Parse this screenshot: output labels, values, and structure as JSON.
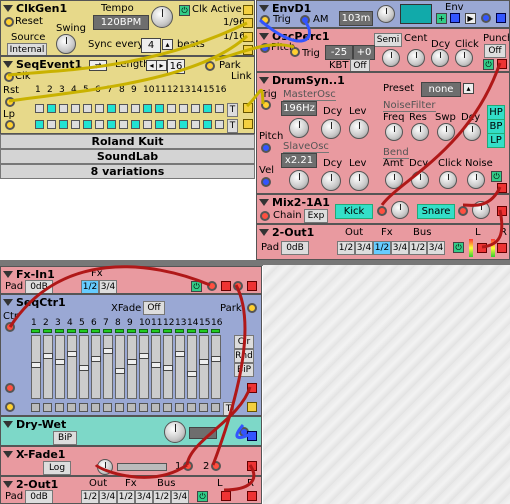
{
  "clkgen": {
    "title": "ClkGen1",
    "reset": "Reset",
    "tempo_label": "Tempo",
    "tempo": "120BPM",
    "swing": "Swing",
    "clk_active": "Clk Active",
    "source": "Source",
    "source_value": "Internal",
    "sync_every": "Sync every",
    "sync_value": "4",
    "beats": "beats",
    "div1": "1/96",
    "div2": "1/16"
  },
  "seqevent": {
    "title": "SeqEvent1",
    "length_label": "Length",
    "length": "16",
    "park": "Park",
    "clk": "Clk",
    "link": "Link",
    "rst": "Rst",
    "lp": "Lp",
    "steps": [
      "1",
      "2",
      "3",
      "4",
      "5",
      "6",
      "7",
      "8",
      "9",
      "10",
      "11",
      "12",
      "13",
      "14",
      "15",
      "16"
    ],
    "row1": [
      0,
      1,
      0,
      0,
      0,
      0,
      1,
      0,
      0,
      1,
      1,
      0,
      0,
      0,
      1,
      0
    ],
    "row2": [
      1,
      0,
      1,
      0,
      1,
      0,
      1,
      0,
      1,
      0,
      1,
      0,
      1,
      0,
      1,
      0
    ],
    "t": "T"
  },
  "info": {
    "line1": "Roland Kuit",
    "line2": "SoundLab",
    "line3": "8 variations"
  },
  "envd": {
    "title": "EnvD1",
    "trig": "Trig",
    "am": "AM",
    "decay": "103m",
    "env": "Env"
  },
  "oscperc": {
    "title": "OscPerc1",
    "pitch": "Pitch",
    "semi": "Semi",
    "cent": "Cent",
    "dcy": "Dcy",
    "click": "Click",
    "punch": "Punch",
    "punch_value": "Off",
    "trig": "Trig",
    "semi_value": "-25",
    "cent_value": "+0",
    "kbt": "KBT",
    "kbt_value": "Off"
  },
  "drumsyn": {
    "title": "DrumSyn..1",
    "trig": "Trig",
    "preset": "Preset",
    "preset_value": "none",
    "masterosc": "MasterOsc",
    "freq": "196Hz",
    "dcy": "Dcy",
    "lev": "Lev",
    "noisefilter": "NoiseFilter",
    "nf_freq": "Freq",
    "nf_res": "Res",
    "nf_swp": "Swp",
    "nf_dcy": "Dcy",
    "hp": "HP",
    "bp": "BP",
    "lp": "LP",
    "pitch": "Pitch",
    "slaveosc": "SlaveOsc",
    "ratio": "x2.21",
    "bend": "Bend",
    "amt": "Amt",
    "bdcy": "Dcy",
    "bclick": "Click",
    "noise": "Noise",
    "vel": "Vel"
  },
  "mix2": {
    "title": "Mix2-1A1",
    "chain": "Chain",
    "exp": "Exp",
    "kick": "Kick",
    "snare": "Snare"
  },
  "out_top": {
    "title": "2-Out1",
    "pad": "Pad",
    "pad_value": "0dB",
    "out": "Out",
    "fx": "Fx",
    "bus": "Bus",
    "o1": "1/2",
    "o2": "3/4",
    "f1": "1/2",
    "f2": "3/4",
    "b1": "1/2",
    "b2": "3/4",
    "l": "L",
    "r": "R"
  },
  "fxin": {
    "title": "Fx-In1",
    "pad": "Pad",
    "pad_value": "0dB",
    "fx": "Fx",
    "f1": "1/2",
    "f2": "3/4",
    "ctr": "Ctr"
  },
  "seqctr": {
    "title": "SeqCtr1",
    "xfade": "XFade",
    "xfade_value": "Off",
    "park": "Park",
    "steps": [
      "1",
      "2",
      "3",
      "4",
      "5",
      "6",
      "7",
      "8",
      "9",
      "10",
      "11",
      "12",
      "13",
      "14",
      "15",
      "16"
    ],
    "levels": [
      0.55,
      0.7,
      0.6,
      0.75,
      0.5,
      0.65,
      0.8,
      0.45,
      0.6,
      0.7,
      0.55,
      0.5,
      0.75,
      0.4,
      0.6,
      0.65
    ],
    "clr": "Clr",
    "rnd": "Rnd",
    "bip": "BiP",
    "t": "T"
  },
  "drywet": {
    "title": "Dry-Wet",
    "bip": "BiP"
  },
  "xfade": {
    "title": "X-Fade1",
    "log": "Log",
    "in1": "1",
    "in2": "2"
  },
  "out_bot": {
    "title": "2-Out1",
    "pad": "Pad",
    "pad_value": "0dB",
    "out": "Out",
    "fx": "Fx",
    "bus": "Bus",
    "o1": "1/2",
    "o2": "3/4",
    "f1": "1/2",
    "f2": "3/4",
    "b1": "1/2",
    "b2": "3/4",
    "l": "L",
    "r": "R"
  }
}
